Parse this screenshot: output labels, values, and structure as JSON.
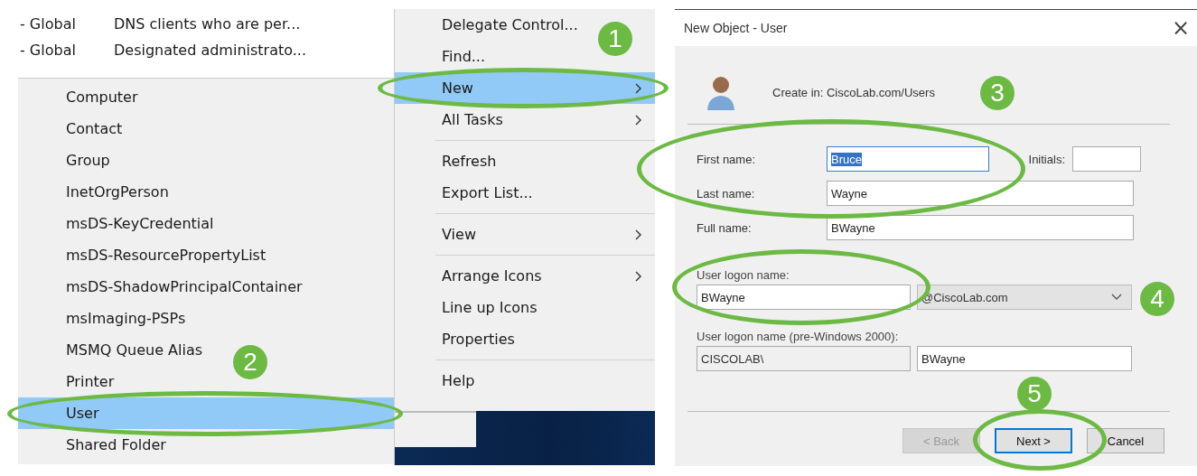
{
  "background_list": {
    "rows": [
      {
        "type": "- Global",
        "description": "DNS clients who are per..."
      },
      {
        "type": "- Global",
        "description": "Designated administrato..."
      }
    ]
  },
  "new_submenu": {
    "items": [
      {
        "label": "Computer",
        "selected": false
      },
      {
        "label": "Contact",
        "selected": false
      },
      {
        "label": "Group",
        "selected": false
      },
      {
        "label": "InetOrgPerson",
        "selected": false
      },
      {
        "label": "msDS-KeyCredential",
        "selected": false
      },
      {
        "label": "msDS-ResourcePropertyList",
        "selected": false
      },
      {
        "label": "msDS-ShadowPrincipalContainer",
        "selected": false
      },
      {
        "label": "msImaging-PSPs",
        "selected": false
      },
      {
        "label": "MSMQ Queue Alias",
        "selected": false
      },
      {
        "label": "Printer",
        "selected": false
      },
      {
        "label": "User",
        "selected": true
      },
      {
        "label": "Shared Folder",
        "selected": false
      }
    ]
  },
  "context_menu": {
    "groups": [
      [
        {
          "label": "Delegate Control...",
          "selected": false,
          "has_submenu": false
        },
        {
          "label": "Find...",
          "selected": false,
          "has_submenu": false
        },
        {
          "label": "New",
          "selected": true,
          "has_submenu": true
        },
        {
          "label": "All Tasks",
          "selected": false,
          "has_submenu": true
        }
      ],
      [
        {
          "label": "Refresh",
          "selected": false,
          "has_submenu": false
        },
        {
          "label": "Export List...",
          "selected": false,
          "has_submenu": false
        }
      ],
      [
        {
          "label": "View",
          "selected": false,
          "has_submenu": true
        }
      ],
      [
        {
          "label": "Arrange Icons",
          "selected": false,
          "has_submenu": true
        },
        {
          "label": "Line up Icons",
          "selected": false,
          "has_submenu": false
        },
        {
          "label": "Properties",
          "selected": false,
          "has_submenu": false
        }
      ],
      [
        {
          "label": "Help",
          "selected": false,
          "has_submenu": false
        }
      ]
    ]
  },
  "dialog": {
    "title": "New Object - User",
    "close": "×",
    "create_in_label": "Create in:",
    "create_in_value": "CiscoLab.com/Users",
    "first_name": {
      "label": "First name:",
      "value": "Bruce",
      "text_selected": true
    },
    "initials": {
      "label": "Initials:"
    },
    "last_name": {
      "label": "Last name:",
      "value": "Wayne"
    },
    "full_name": {
      "label": "Full name:",
      "value": "BWayne"
    },
    "logon_name": {
      "label": "User logon name:",
      "value": "BWayne",
      "domain": "@CiscoLab.com"
    },
    "pre2000": {
      "label": "User logon name (pre-Windows 2000):",
      "domain": "CISCOLAB\\",
      "value": "BWayne"
    },
    "buttons": [
      {
        "label": "< Back",
        "disabled": true,
        "default": false
      },
      {
        "label": "Next >",
        "disabled": false,
        "default": true
      },
      {
        "label": "Cancel",
        "disabled": false,
        "default": false
      }
    ]
  },
  "step_badges": [
    "1",
    "2",
    "3",
    "4",
    "5"
  ]
}
